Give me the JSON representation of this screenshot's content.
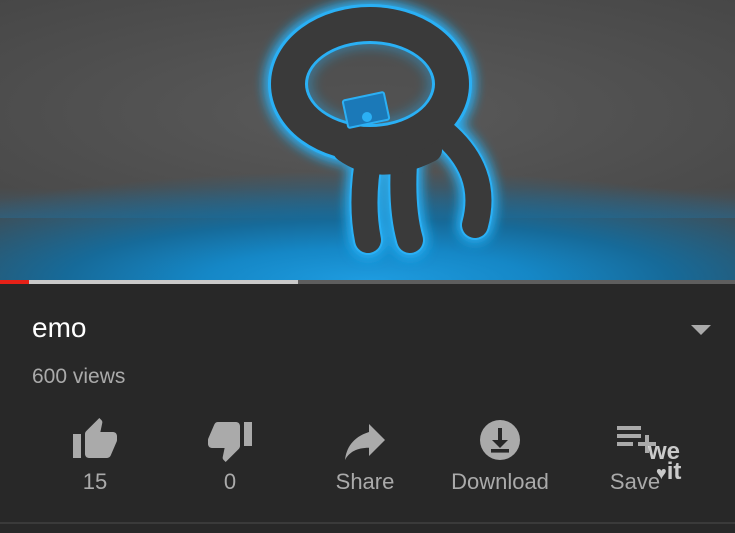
{
  "video": {
    "title": "emo",
    "views": "600 views",
    "progress_played_fraction": 0.04,
    "progress_buffered_fraction": 0.405
  },
  "actions": [
    {
      "icon": "thumbs-up-icon",
      "label": "15"
    },
    {
      "icon": "thumbs-down-icon",
      "label": "0"
    },
    {
      "icon": "share-icon",
      "label": "Share"
    },
    {
      "icon": "download-icon",
      "label": "Download"
    },
    {
      "icon": "save-playlist-icon",
      "label": "Save"
    }
  ],
  "watermark": {
    "line1": "we",
    "line2": "it"
  },
  "colors": {
    "background": "#282828",
    "title": "#ffffff",
    "secondary_text": "#aaaaaa",
    "progress_played": "#e62117",
    "glow": "#1e9ce0"
  }
}
